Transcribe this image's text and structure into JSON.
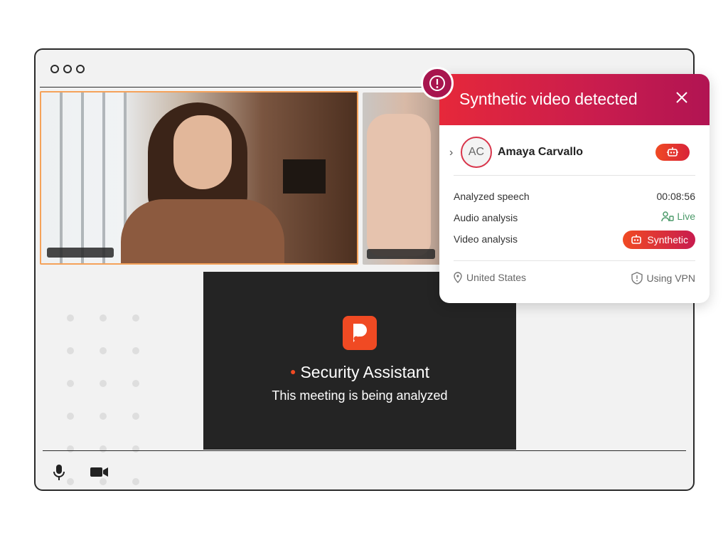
{
  "alert": {
    "title": "Synthetic video detected",
    "participant": {
      "initials": "AC",
      "name": "Amaya Carvallo"
    },
    "details": [
      {
        "label": "Analyzed speech",
        "value": "00:08:56"
      },
      {
        "label": "Audio analysis",
        "value": "Live"
      },
      {
        "label": "Video analysis",
        "value": "Synthetic"
      }
    ],
    "location": "United States",
    "network": "Using VPN"
  },
  "assistant": {
    "title": "Security Assistant",
    "subtitle": "This meeting is being analyzed"
  },
  "icons": {
    "alert": "exclamation-circle-icon",
    "close": "close-icon",
    "mic": "microphone-icon",
    "camera": "video-camera-icon",
    "location": "map-pin-icon",
    "vpn": "shield-icon",
    "live": "user-voice-icon",
    "synthetic": "robot-icon"
  },
  "colors": {
    "accent_red": "#e6283a",
    "accent_orange": "#f04a23",
    "live_green": "#4c9a6a",
    "main_tile_border": "#f5a25a"
  }
}
